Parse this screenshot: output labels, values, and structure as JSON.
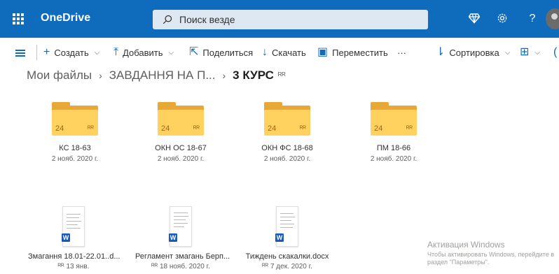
{
  "header": {
    "app_name": "OneDrive",
    "search_placeholder": "Поиск везде",
    "accent": "#0f6cbd",
    "icons": [
      "waffle-icon",
      "premium-diamond-icon",
      "settings-gear-icon",
      "help-icon",
      "avatar"
    ]
  },
  "commands": {
    "create": "Создать",
    "add": "Добавить",
    "share": "Поделиться",
    "download": "Скачать",
    "move": "Переместить",
    "more": "···",
    "sort": "Сортировка"
  },
  "breadcrumb": {
    "root": "Мои файлы",
    "parent": "ЗАВДАННЯ НА П...",
    "current": "3 КУРС"
  },
  "folders": [
    {
      "name": "КС 18-63",
      "date": "2 нояб. 2020 г.",
      "count": "24"
    },
    {
      "name": "ОКН ОС 18-67",
      "date": "2 нояб. 2020 г.",
      "count": "24"
    },
    {
      "name": "ОКН ФС 18-68",
      "date": "2 нояб. 2020 г.",
      "count": "24"
    },
    {
      "name": "ПМ 18-66",
      "date": "2 нояб. 2020 г.",
      "count": "24"
    }
  ],
  "files": [
    {
      "name": "Змагання 18.01-22.01..d...",
      "date": "13 янв."
    },
    {
      "name": "Регламент змагань Берп...",
      "date": "18 нояб. 2020 г."
    },
    {
      "name": "Тиждень скакалки.docx",
      "date": "7 дек. 2020 г."
    }
  ],
  "watermark": {
    "title": "Активация Windows",
    "text": "Чтобы активировать Windows, перейдите в раздел \"Параметры\"."
  }
}
